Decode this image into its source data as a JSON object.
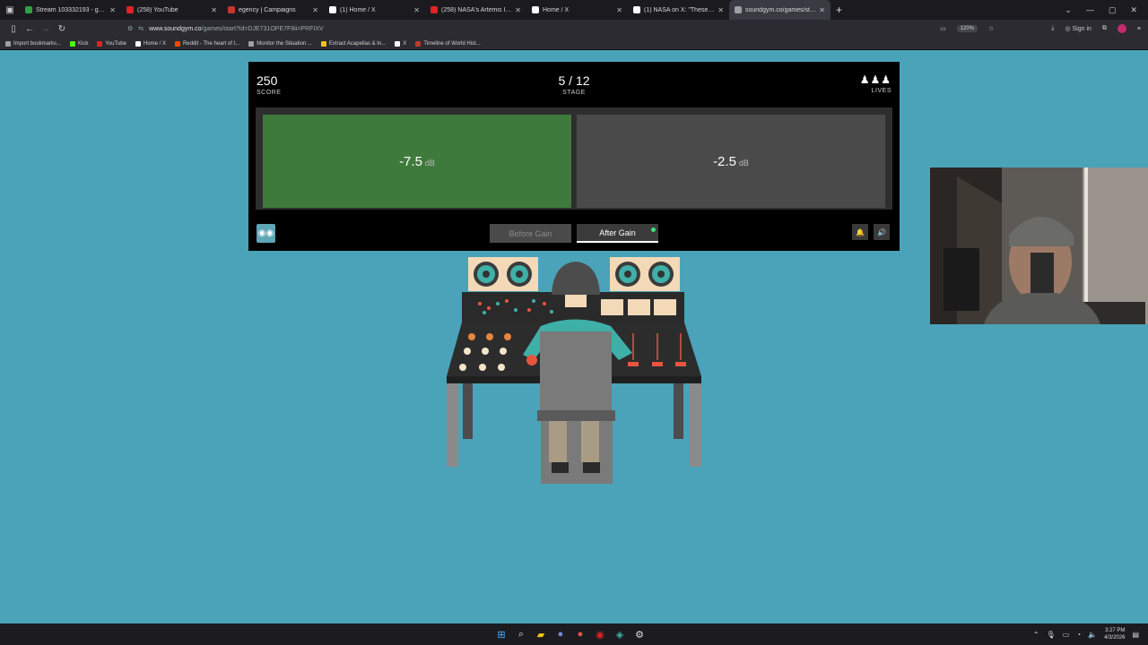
{
  "browser": {
    "tabs": [
      {
        "label": "Stream 103332193 - garydavid",
        "color": "#2ea043"
      },
      {
        "label": "(258) YouTube",
        "color": "#e02424"
      },
      {
        "label": "egency | Campaigns",
        "color": "#c0392b"
      },
      {
        "label": "(1) Home / X",
        "color": "#ffffff"
      },
      {
        "label": "(258) NASA's Artemis II Live Mi",
        "color": "#e02424"
      },
      {
        "label": "Home / X",
        "color": "#ffffff"
      },
      {
        "label": "(1) NASA on X: \"These two ima",
        "color": "#ffffff"
      },
      {
        "label": "soundgym.co/games/start",
        "color": "#9aa0a6"
      }
    ],
    "url_host": "www.soundgym.co",
    "url_path": "/games/start?id=DJE731OPE7F8ii=PRFIXV",
    "zoom": "120%",
    "signin": "Sign in",
    "bookmarks": [
      {
        "label": "Import bookmarks...",
        "color": "#9aa0a6"
      },
      {
        "label": "Kick",
        "color": "#53fc18"
      },
      {
        "label": "YouTube",
        "color": "#e02424"
      },
      {
        "label": "Home / X",
        "color": "#ffffff"
      },
      {
        "label": "Reddit - The heart of t...",
        "color": "#ff4500"
      },
      {
        "label": "Monitor the Situation ...",
        "color": "#9aa0a6"
      },
      {
        "label": "Extract Acapellas & In...",
        "color": "#f1c40f"
      },
      {
        "label": "X",
        "color": "#ffffff"
      },
      {
        "label": "Timeline of World Hist...",
        "color": "#c0392b"
      }
    ]
  },
  "game": {
    "score": "250",
    "score_label": "SCORE",
    "stage": "5 / 12",
    "stage_label": "STAGE",
    "lives_label": "LIVES",
    "lives_count": 3,
    "answer_a": "-7.5",
    "answer_b": "-2.5",
    "unit": "dB",
    "before_label": "Before Gain",
    "after_label": "After Gain"
  },
  "taskbar": {
    "time": "3:27 PM",
    "date": "4/3/2026"
  }
}
